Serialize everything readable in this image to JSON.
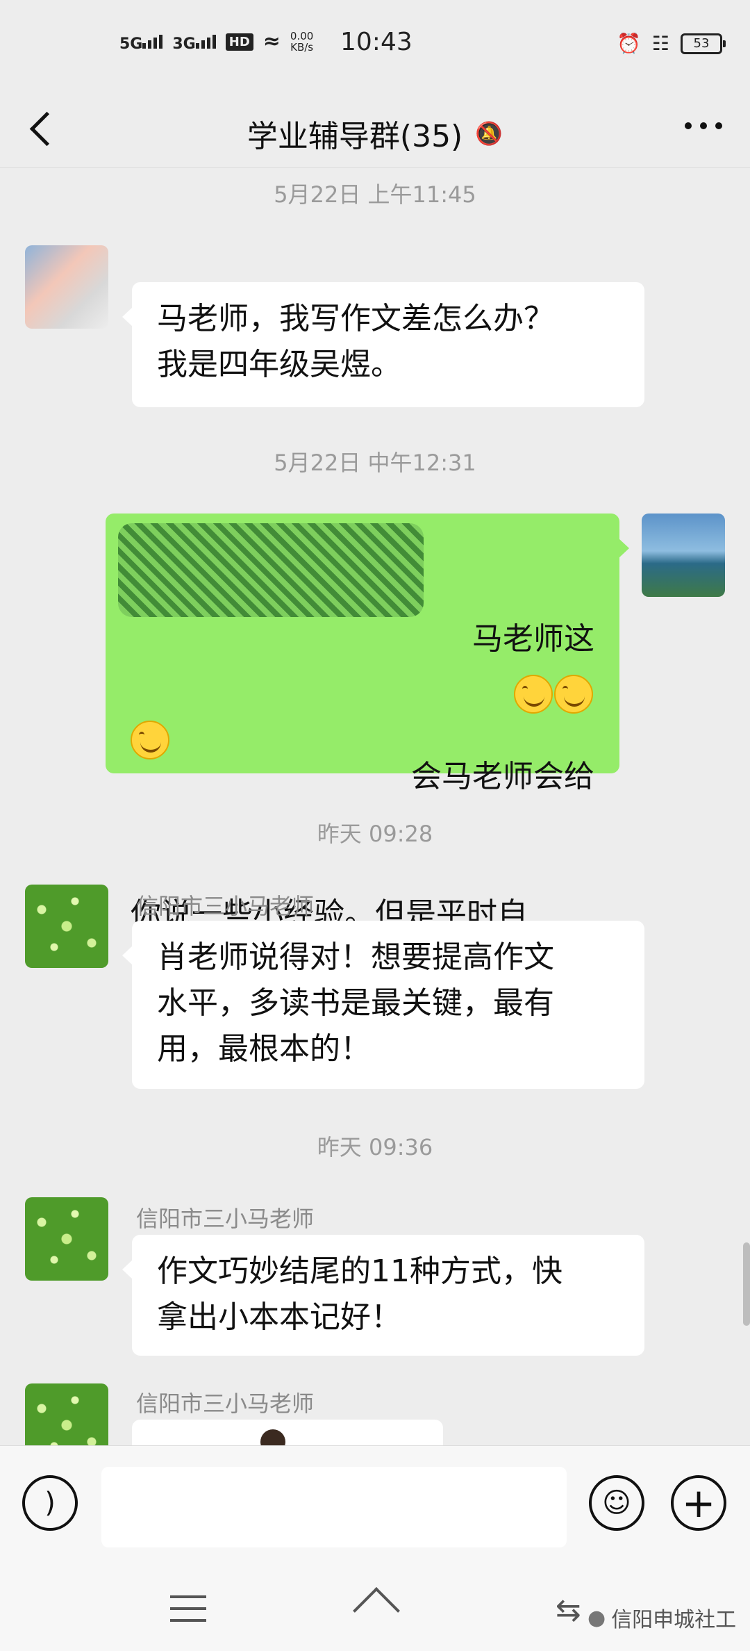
{
  "status_bar": {
    "net1": "5G",
    "net2": "3G",
    "hd": "HD",
    "speed_value": "0.00",
    "speed_unit": "KB/s",
    "time": "10:43",
    "battery": "53"
  },
  "header": {
    "title": "学业辅导群(35)",
    "mute_icon": "bell-off-icon",
    "more_icon": "more-dots-icon",
    "back_icon": "back-chevron-icon"
  },
  "messages": [
    {
      "type": "timestamp",
      "text": "5月22日 上午11:45"
    },
    {
      "type": "incoming",
      "avatar": "blurred",
      "sender": "",
      "text": "马老师，我写作文差怎么办？\n我是四年级吴煜。"
    },
    {
      "type": "timestamp",
      "text": "5月22日 中午12:31"
    },
    {
      "type": "outgoing",
      "avatar": "lake",
      "line1_visible": "马老师这",
      "line2_visible": "会马老师会给",
      "text_rest": "你说一些小经验。但是平时自\n己也得多读书，多阅读。",
      "emoji_count": 3,
      "emoji_name": "smile-emoji"
    },
    {
      "type": "timestamp",
      "text": "昨天 09:28"
    },
    {
      "type": "incoming",
      "avatar": "moss",
      "sender": "信阳市三小马老师",
      "text": "肖老师说得对！想要提高作文\n水平，多读书是最关键，最有\n用，最根本的！"
    },
    {
      "type": "timestamp",
      "text": "昨天 09:36"
    },
    {
      "type": "incoming",
      "avatar": "moss",
      "sender": "信阳市三小马老师",
      "text": "作文巧妙结尾的11种方式，快\n拿出小本本记好！"
    },
    {
      "type": "incoming",
      "avatar": "moss",
      "sender": "信阳市三小马老师",
      "text": ""
    }
  ],
  "input_bar": {
    "voice_icon": "voice-icon",
    "emoji_icon": "emoji-icon",
    "plus_icon": "plus-icon",
    "placeholder": ""
  },
  "system_nav": {
    "watermark": "信阳申城社工"
  }
}
